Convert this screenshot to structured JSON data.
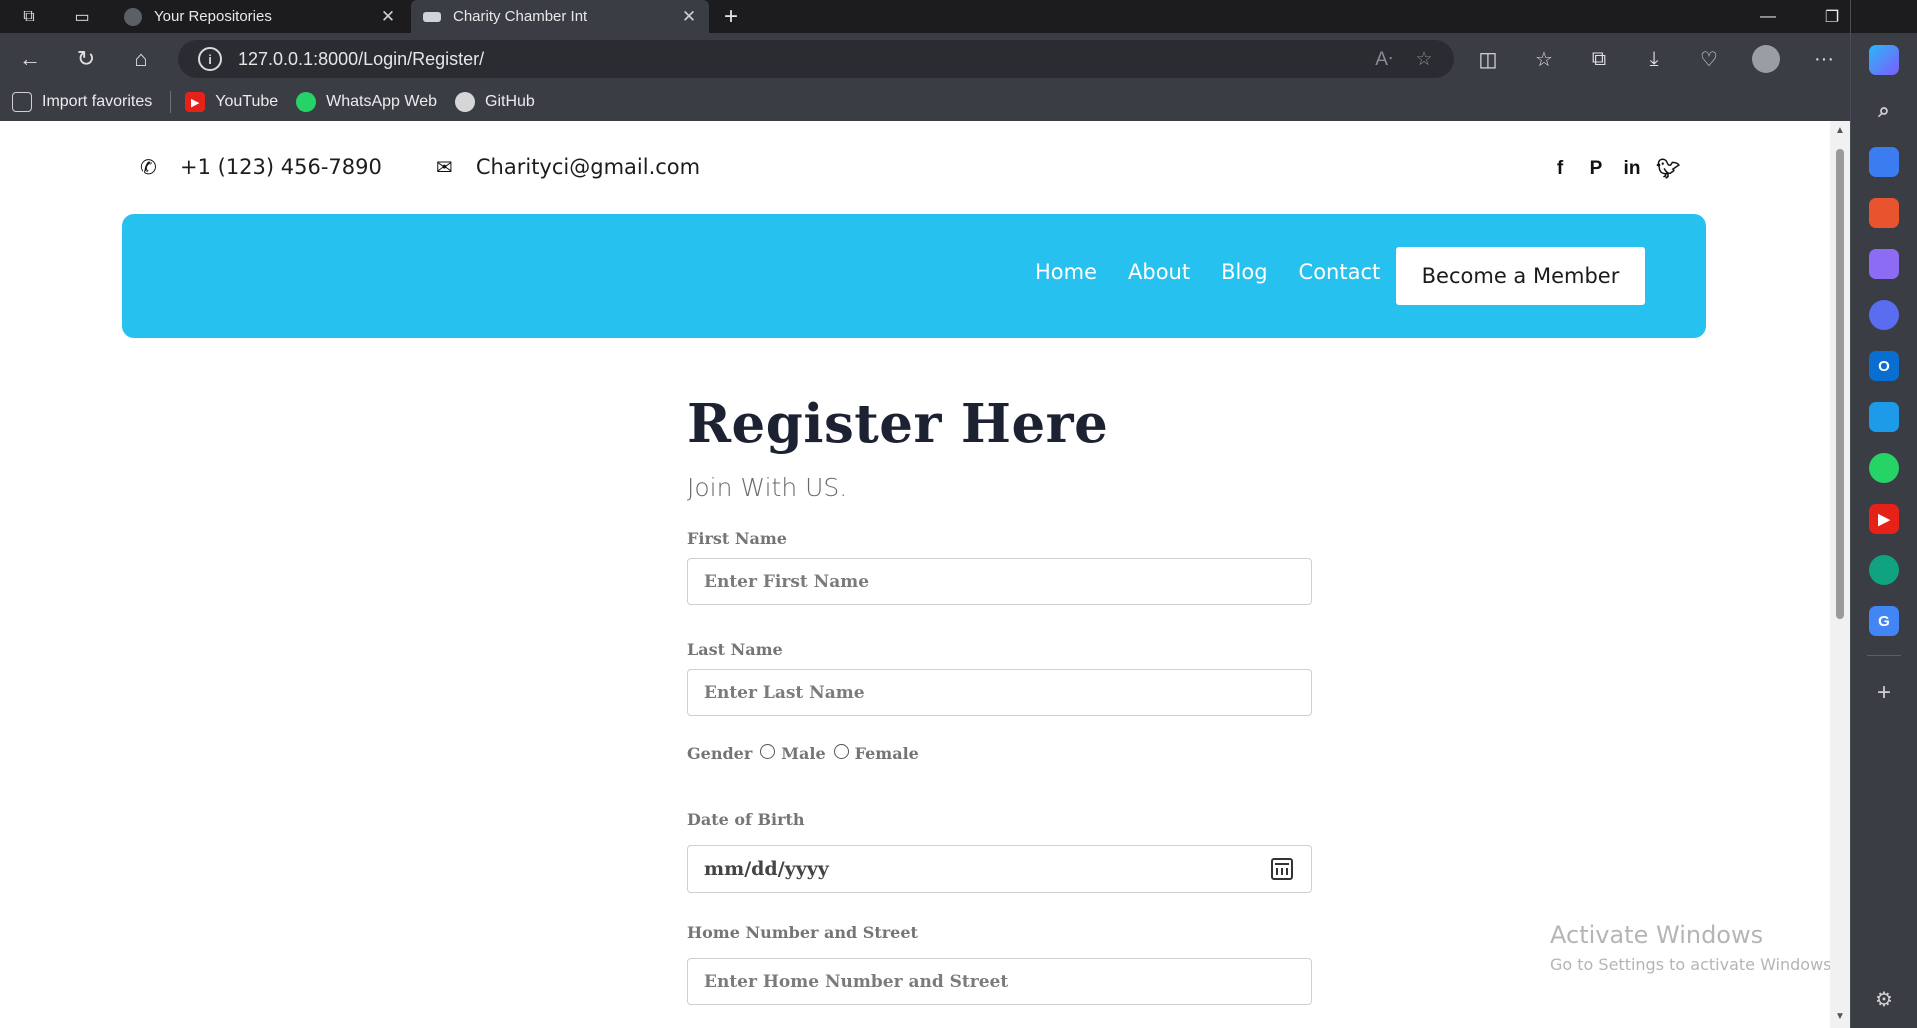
{
  "browser": {
    "tabs": [
      {
        "title": "Your Repositories",
        "active": false
      },
      {
        "title": "Charity Chamber Int",
        "active": true
      }
    ],
    "address": "127.0.0.1:8000/Login/Register/",
    "favorites": [
      {
        "label": "Import favorites",
        "icon": "import-icon"
      },
      {
        "label": "YouTube",
        "icon": "youtube-icon"
      },
      {
        "label": "WhatsApp Web",
        "icon": "whatsapp-icon"
      },
      {
        "label": "GitHub",
        "icon": "github-icon"
      }
    ],
    "colors": {
      "tab_bar": "#1c1c1e",
      "toolbar": "#3a3d44",
      "omnibox": "#2a2c31"
    }
  },
  "site": {
    "phone": "+1 (123) 456-7890",
    "email": "Charityci@gmail.com",
    "socials": [
      "facebook-icon",
      "pinterest-icon",
      "linkedin-icon",
      "twitter-icon"
    ],
    "nav": {
      "links": [
        "Home",
        "About",
        "Blog",
        "Contact"
      ],
      "cta": "Become a Member"
    },
    "colors": {
      "accent": "#27c1ef",
      "title": "#1d2233"
    }
  },
  "form": {
    "title": "Register Here",
    "subtitle": "Join With US.",
    "first_name": {
      "label": "First Name",
      "placeholder": "Enter First Name"
    },
    "last_name": {
      "label": "Last Name",
      "placeholder": "Enter Last Name"
    },
    "gender": {
      "label": "Gender",
      "options": [
        "Male",
        "Female"
      ]
    },
    "dob": {
      "label": "Date of Birth",
      "value": "mm/dd/yyyy"
    },
    "street": {
      "label": "Home Number and Street",
      "placeholder": "Enter Home Number and Street"
    }
  },
  "watermark": {
    "line1": "Activate Windows",
    "line2": "Go to Settings to activate Windows."
  }
}
